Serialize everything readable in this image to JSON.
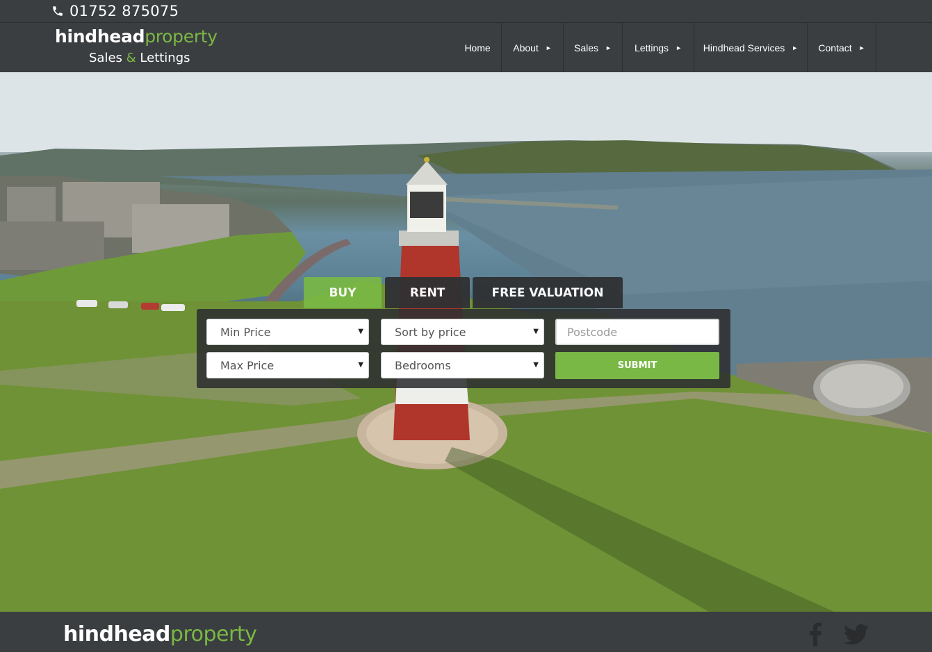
{
  "topbar": {
    "phone": "01752 875075",
    "phone_icon": "phone-icon"
  },
  "logo": {
    "word1": "hindhead",
    "word2": "property",
    "tag1": "Sales ",
    "tag_amp": "&",
    "tag2": " Lettings"
  },
  "nav": {
    "items": [
      {
        "label": "Home",
        "has_submenu": false
      },
      {
        "label": "About",
        "has_submenu": true
      },
      {
        "label": "Sales",
        "has_submenu": true
      },
      {
        "label": "Lettings",
        "has_submenu": true
      },
      {
        "label": "Hindhead Services",
        "has_submenu": true
      },
      {
        "label": "Contact",
        "has_submenu": true
      }
    ],
    "submenu_glyph": "►"
  },
  "search": {
    "tabs": {
      "buy": "BUY",
      "rent": "RENT",
      "valuation": "FREE VALUATION"
    },
    "active_tab": "BUY",
    "min_price": "Min Price",
    "max_price": "Max Price",
    "sort": "Sort by price",
    "bedrooms": "Bedrooms",
    "postcode_placeholder": "Postcode",
    "submit_label": "SUBMIT",
    "caret": "▼"
  },
  "footer": {
    "logo_word1": "hindhead",
    "logo_word2": "property",
    "social": [
      "facebook-icon",
      "twitter-icon"
    ]
  },
  "colors": {
    "accent": "#7ab843",
    "bar": "#3b3e41",
    "tab_dark": "#2f3133"
  }
}
